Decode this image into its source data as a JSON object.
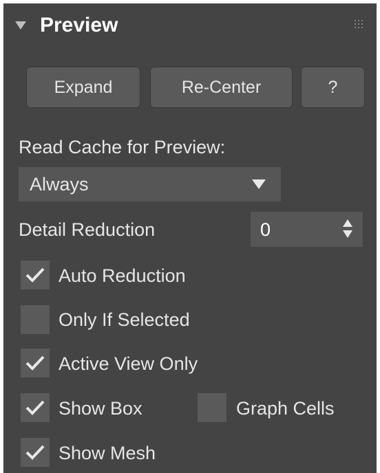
{
  "header": {
    "title": "Preview",
    "collapse_icon": "triangle-down-icon",
    "grip_icon": "grip-dots-icon"
  },
  "buttons": {
    "expand": "Expand",
    "recenter": "Re-Center",
    "help": "?"
  },
  "read_cache": {
    "label": "Read Cache for Preview:",
    "selected": "Always"
  },
  "detail_reduction": {
    "label": "Detail Reduction",
    "value": "0"
  },
  "checkboxes": {
    "auto_reduction": {
      "label": "Auto Reduction",
      "checked": true
    },
    "only_if_selected": {
      "label": "Only If Selected",
      "checked": false
    },
    "active_view_only": {
      "label": "Active View Only",
      "checked": true
    },
    "show_box": {
      "label": "Show Box",
      "checked": true
    },
    "graph_cells": {
      "label": "Graph Cells",
      "checked": false
    },
    "show_mesh": {
      "label": "Show Mesh",
      "checked": true
    }
  },
  "colors": {
    "panel_bg": "#444444",
    "control_bg": "#5a5a5a",
    "text": "#e6e6e6"
  }
}
